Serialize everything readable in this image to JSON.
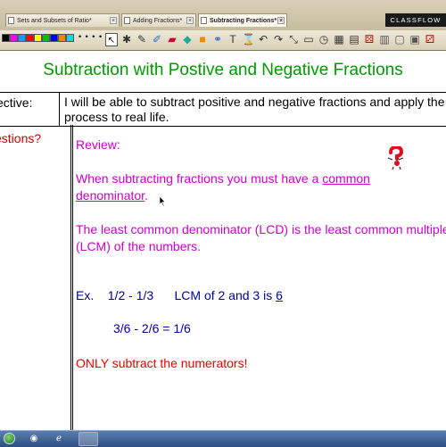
{
  "tabs": [
    {
      "label": "Sets and Subsets of Ratio*",
      "active": false
    },
    {
      "label": "Adding Fractions*",
      "active": false
    },
    {
      "label": "Subtracting Fractions*",
      "active": true
    }
  ],
  "brand": "CLASSFLOW",
  "toolbar": {
    "colors": [
      "#000000",
      "#ff00ff",
      "#00a0ff",
      "#ff0000",
      "#ffff00",
      "#00c000",
      "#0000ff",
      "#ff8000",
      "#00e0e0"
    ],
    "dots": "• • • •",
    "tools": [
      "arrow-pointer-icon",
      "wrench-icon",
      "pen-icon",
      "highlighter-icon",
      "eraser-icon",
      "fill-icon",
      "shape-icon",
      "link-icon",
      "text-icon",
      "hourglass-icon",
      "undo-icon",
      "redo-icon",
      "pan-icon",
      "projector-icon",
      "clock-icon",
      "calculator-icon",
      "keyboard-icon",
      "dice-icon"
    ],
    "text_tool": "T"
  },
  "page": {
    "title": "Subtraction with Postive and Negative Fractions",
    "objective_label": "ective:",
    "objective_text": "I will be able to subtract positive and negative fractions and apply the process to real life.",
    "questions_label": "estions?",
    "review": "Review:",
    "para1_pre": "When subtracting fractions you must have a ",
    "para1_link": "common denominator",
    "para1_post": ".",
    "para2": "The least common denominator (LCD) is the least common multiple (LCM) of the numbers.",
    "ex1_pre": "Ex.    1/2 - 1/3      LCM of 2 and 3 is ",
    "ex1_answer": "6",
    "ex2": "3/6 - 2/6 = 1/6",
    "warning": "ONLY subtract the numerators!"
  },
  "colors": {
    "title": "#009900",
    "review_text": "#cc00cc",
    "example_text": "#000099",
    "warning_text": "#ee0000"
  }
}
